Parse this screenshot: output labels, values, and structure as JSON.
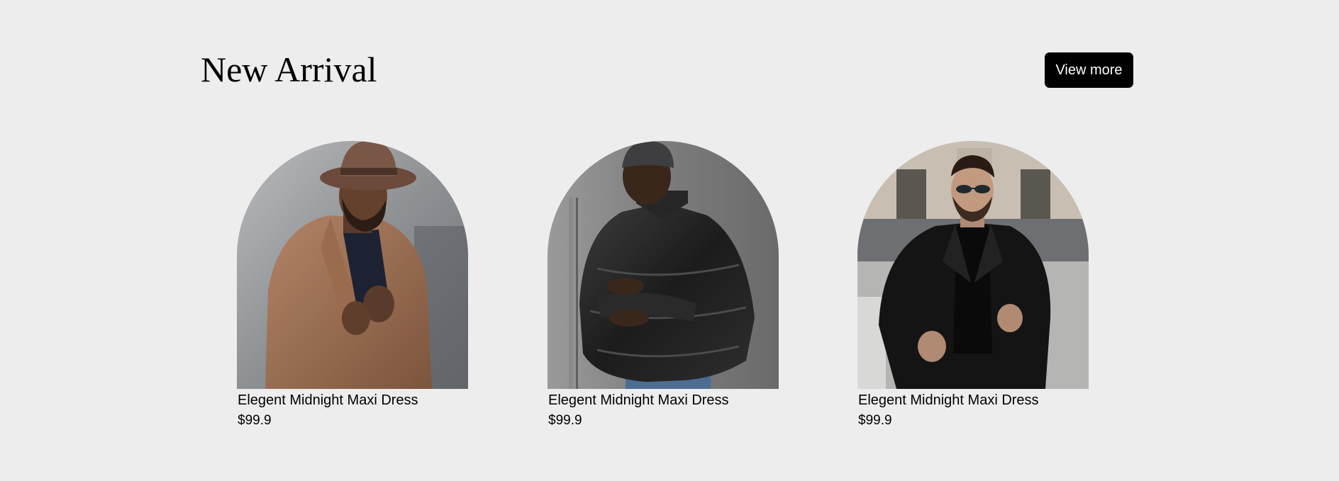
{
  "section": {
    "title": "New Arrival",
    "view_more_label": "View more"
  },
  "products": [
    {
      "name": "Elegent Midnight Maxi Dress",
      "price": "$99.9",
      "image": "man-in-brown-coat-and-fedora-hat"
    },
    {
      "name": "Elegent Midnight Maxi Dress",
      "price": "$99.9",
      "image": "man-in-black-puffer-jacket-and-beanie"
    },
    {
      "name": "Elegent Midnight Maxi Dress",
      "price": "$99.9",
      "image": "man-in-black-suit-and-sunglasses"
    }
  ],
  "colors": {
    "background": "#ededed",
    "button_bg": "#000000",
    "button_text": "#ffffff",
    "text": "#000000"
  }
}
